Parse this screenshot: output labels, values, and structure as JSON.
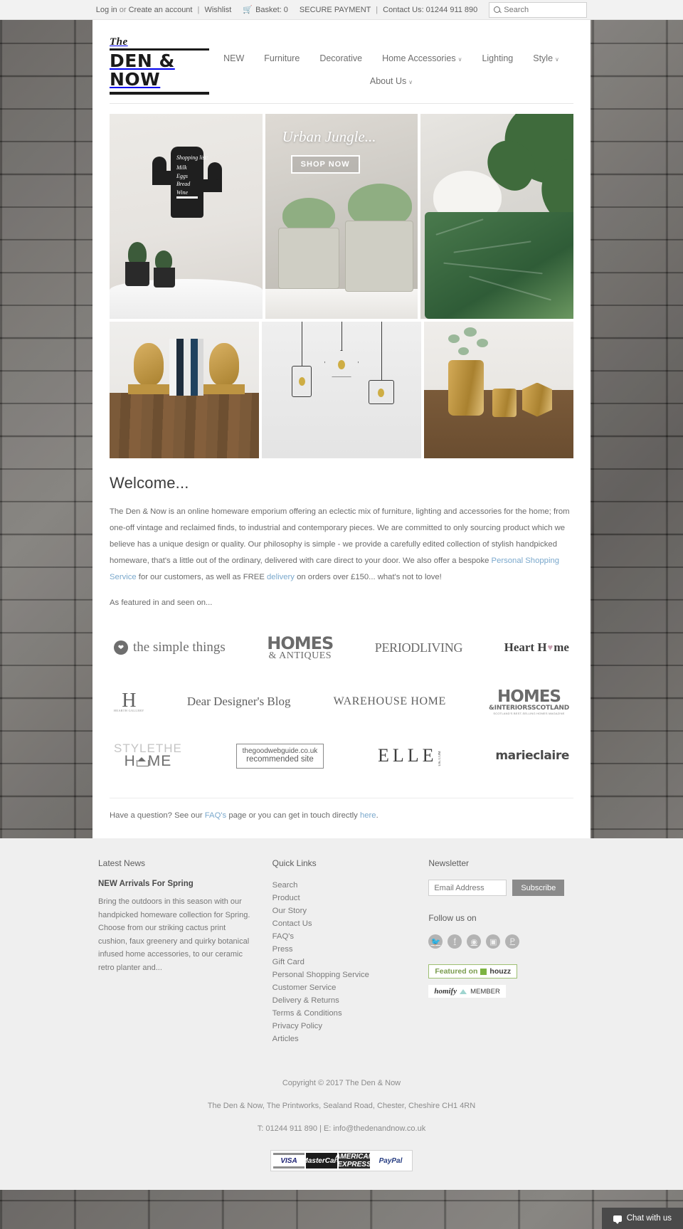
{
  "topbar": {
    "login": "Log in",
    "or": "or",
    "create_account": "Create an account",
    "sep": "|",
    "wishlist": "Wishlist",
    "cart_icon": "cart-icon",
    "basket": "Basket: 0",
    "secure_payment": "SECURE PAYMENT",
    "contact": "Contact Us: 01244 911 890",
    "search_placeholder": "Search",
    "search_value": ""
  },
  "logo": {
    "the": "The",
    "main": "DEN & NOW"
  },
  "nav": {
    "row1": [
      {
        "label": "NEW",
        "caret": false
      },
      {
        "label": "Furniture",
        "caret": false
      },
      {
        "label": "Decorative",
        "caret": false
      },
      {
        "label": "Home Accessories",
        "caret": true
      },
      {
        "label": "Lighting",
        "caret": false
      },
      {
        "label": "Style",
        "caret": true
      }
    ],
    "row2": [
      {
        "label": "About Us",
        "caret": true
      }
    ],
    "caret_glyph": "∨"
  },
  "hero": {
    "cactus": {
      "list_title": "Shopping list:",
      "items": "Milk\nEggs\nBread\nWine"
    },
    "jungle": {
      "title": "Urban Jungle...",
      "cta": "SHOP NOW"
    }
  },
  "welcome": {
    "title": "Welcome...",
    "p1_a": "The Den & Now is an online homeware emporium offering an eclectic mix of furniture, lighting and accessories for the home; from one-off vintage and reclaimed finds, to industrial and contemporary pieces. We are committed to only sourcing product which we believe has a unique design or quality. Our philosophy is simple - we provide a carefully edited collection of stylish handpicked homeware, that's a little out of the ordinary, delivered with care direct to your door. We also offer a bespoke ",
    "link_shopping": "Personal Shopping Service",
    "p1_b": " for our customers, as well as FREE ",
    "link_delivery": "delivery",
    "p1_c": " on orders over £150... what's not to love!",
    "featured_line": "As featured in and seen on..."
  },
  "press": {
    "row1": [
      {
        "name": "the simple things",
        "icon": "heart-icon"
      },
      {
        "name": "HOMES",
        "sub": "& ANTIQUES"
      },
      {
        "name": "PERIODLIVING"
      },
      {
        "name": "Heart H",
        "suffix": "me"
      }
    ],
    "row2": [
      {
        "name": "H",
        "sub": "HEARTH GALLERY"
      },
      {
        "name": "Dear Designer's Blog"
      },
      {
        "name": "WAREHOUSE HOME"
      },
      {
        "name": "HOMES",
        "sub": "&INTERIORSSCOTLAND",
        "sub2": "SCOTLAND'S BEST-SELLING HOMES MAGAZINE"
      }
    ],
    "row3": [
      {
        "name_top": "STYLETHE",
        "name_bottom_a": "H",
        "name_bottom_b": "ME"
      },
      {
        "line1": "thegoodwebguide.co.uk",
        "line2": "recommended site"
      },
      {
        "name": "ELLE",
        "sub": "UK.COM"
      },
      {
        "name": "marieclaire"
      }
    ]
  },
  "question": {
    "before": "Have a question? See our ",
    "link_faq": "FAQ's",
    "middle": " page or you can get in touch directly ",
    "link_here": "here",
    "after": "."
  },
  "footer": {
    "news": {
      "heading": "Latest News",
      "title": "NEW Arrivals For Spring",
      "body": "Bring the outdoors in this season with our handpicked homeware collection for Spring. Choose from our striking cactus print cushion, faux greenery and quirky botanical infused home accessories, to our ceramic retro planter and..."
    },
    "quick_links": {
      "heading": "Quick Links",
      "items": [
        "Search",
        "Product",
        "Our Story",
        "Contact Us",
        "FAQ's",
        "Press",
        "Gift Card",
        "Personal Shopping Service",
        "Customer Service",
        "Delivery & Returns",
        "Terms & Conditions",
        "Privacy Policy",
        "Articles"
      ]
    },
    "newsletter": {
      "heading": "Newsletter",
      "placeholder": "Email Address",
      "value": "",
      "subscribe": "Subscribe",
      "follow_heading": "Follow us on",
      "social": [
        {
          "name": "twitter-icon",
          "glyph": "✉"
        },
        {
          "name": "facebook-icon",
          "glyph": "f"
        },
        {
          "name": "rss-icon",
          "glyph": "◠"
        },
        {
          "name": "instagram-icon",
          "glyph": "▣"
        },
        {
          "name": "pinterest-icon",
          "glyph": "P"
        }
      ],
      "houzz_badge": "Featured on",
      "houzz_name": "houzz",
      "homify_name": "homify",
      "homify_member": "MEMBER"
    },
    "bottom": {
      "copyright": "Copyright © 2017 The Den & Now",
      "address": "The Den & Now, The Printworks, Sealand Road, Chester, Cheshire CH1 4RN",
      "contact": "T: 01244 911 890 | E: info@thedenandnow.co.uk",
      "payments": [
        "VISA",
        "MasterCard",
        "AMERICAN EXPRESS",
        "PayPal"
      ]
    }
  },
  "chat": {
    "label": "Chat with us",
    "icon": "chat-bubble-icon"
  },
  "colors": {
    "link": "#7aa8cc",
    "topbar_bg": "#f2f2f2",
    "footer_bg": "#efefef",
    "chat_bg": "#4a4a4a"
  }
}
